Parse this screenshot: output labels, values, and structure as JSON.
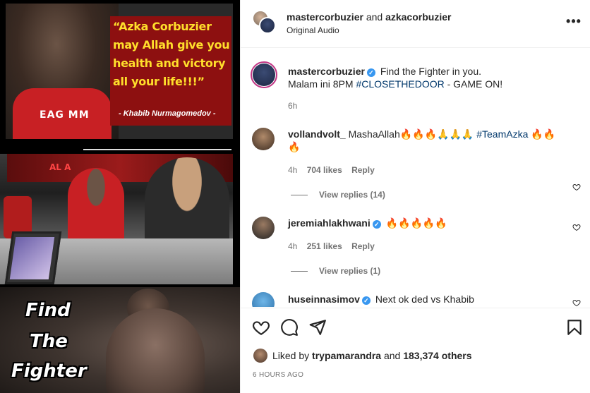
{
  "media": {
    "quote": "“Azka Corbuzier may Allah give you health and victory all your life!!!”",
    "quote_credit": "- Khabib Nurmagomedov -",
    "shirt_text": "EAG MM",
    "wall_logo": "AL A",
    "panel3_words": [
      "Find",
      "The",
      "Fighter"
    ]
  },
  "header": {
    "user1": "mastercorbuzier",
    "conjunction": "and",
    "user2": "azkacorbuzier",
    "audio": "Original Audio",
    "more_label": "•••"
  },
  "caption": {
    "username": "mastercorbuzier",
    "text1": "Find the Fighter in you.",
    "text2_prefix": "Malam ini 8PM ",
    "hashtag": "#CLOSETHEDOOR",
    "text2_suffix": " - GAME ON!",
    "time": "6h"
  },
  "comments": [
    {
      "username": "vollandvolt_",
      "text": "MashaAllah🔥🔥🔥🙏🙏🙏 ",
      "hashtag": "#TeamAzka",
      "text_after": " 🔥🔥🔥",
      "time": "4h",
      "likes": "704 likes",
      "reply": "Reply",
      "view_replies": "View replies (14)"
    },
    {
      "username": "jeremiahlakhwani",
      "text": "🔥🔥🔥🔥🔥",
      "time": "4h",
      "likes": "251 likes",
      "reply": "Reply",
      "view_replies": "View replies (1)"
    },
    {
      "username": "huseinnasimov",
      "text": "Next ok ded vs Khabib"
    }
  ],
  "footer": {
    "liked_by_prefix": "Liked by ",
    "liked_by_user": "trypamarandra",
    "liked_by_and": " and ",
    "liked_by_others": "183,374 others",
    "posted": "6 HOURS AGO"
  },
  "colors": {
    "link": "#00376b",
    "verified": "#3897f0",
    "muted": "#737373",
    "quote_yellow": "#ffdf2b"
  }
}
